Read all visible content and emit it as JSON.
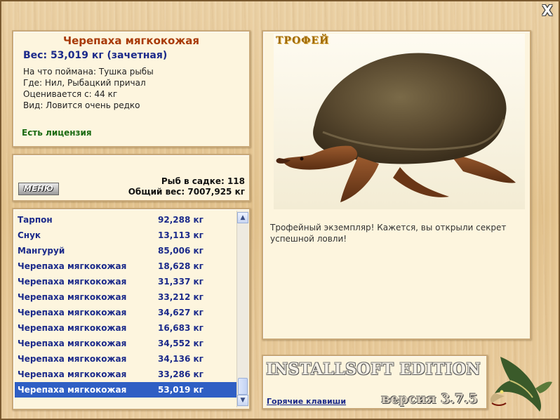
{
  "window": {
    "close_glyph": "X"
  },
  "info": {
    "title": "Черепаха мягкокожая",
    "weight": "Вес: 53,019 кг (зачетная)",
    "lines": [
      "На что поймана: Тушка рыбы",
      "Где: Нил, Рыбацкий причал",
      "Оценивается с: 44 кг",
      "Вид: Ловится очень редко"
    ],
    "license": "Есть лицензия"
  },
  "stats": {
    "menu_label": "МЕНЮ",
    "fish_in_net": "Рыб в садке: 118",
    "total_weight": "Общий вес: 7007,925 кг"
  },
  "catch_list": [
    {
      "name": "Тарпон",
      "weight": "92,288 кг"
    },
    {
      "name": "Снук",
      "weight": "13,113 кг"
    },
    {
      "name": "Мангуруй",
      "weight": "85,006 кг"
    },
    {
      "name": "Черепаха мягкокожая",
      "weight": "18,628 кг"
    },
    {
      "name": "Черепаха мягкокожая",
      "weight": "31,337 кг"
    },
    {
      "name": "Черепаха мягкокожая",
      "weight": "33,212 кг"
    },
    {
      "name": "Черепаха мягкокожая",
      "weight": "34,627 кг"
    },
    {
      "name": "Черепаха мягкокожая",
      "weight": "16,683 кг"
    },
    {
      "name": "Черепаха мягкокожая",
      "weight": "34,552 кг"
    },
    {
      "name": "Черепаха мягкокожая",
      "weight": "34,136 кг"
    },
    {
      "name": "Черепаха мягкокожая",
      "weight": "33,286 кг"
    },
    {
      "name": "Черепаха мягкокожая",
      "weight": "53,019 кг"
    }
  ],
  "catch_list_selected_index": 11,
  "trophy": {
    "label": "ТРОФЕЙ",
    "description": "Трофейный экземпляр! Кажется, вы открыли секрет успешной ловли!"
  },
  "footer": {
    "edition": "INSTALLSOFT EDITION",
    "hotkeys": "Горячие клавиши",
    "version": "версия 3.7.5"
  },
  "colors": {
    "title": "#a83a08",
    "weight": "#1b2a8a",
    "license": "#1a6a12",
    "list_text": "#1b2a8a",
    "selection": "#2f5fc4",
    "trophy_label": "#a06a08"
  },
  "icons": [
    "close-icon",
    "turtle-image",
    "pike-fish-icon",
    "scroll-up-icon",
    "scroll-down-icon"
  ]
}
